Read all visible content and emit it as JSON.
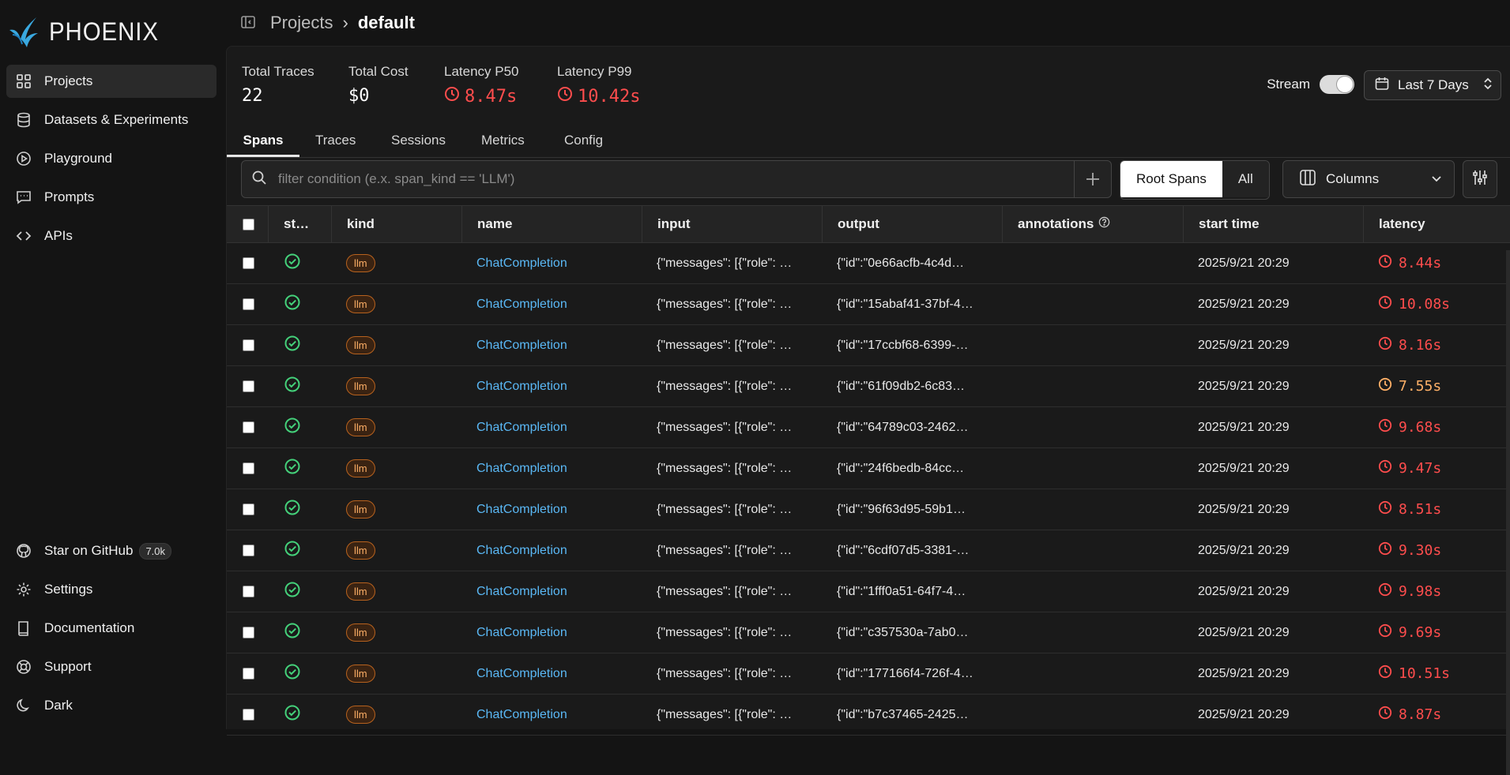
{
  "app": {
    "name": "PHOENIX"
  },
  "sidebar": {
    "items": [
      {
        "label": "Projects",
        "icon": "grid-icon",
        "active": true
      },
      {
        "label": "Datasets & Experiments",
        "icon": "database-icon"
      },
      {
        "label": "Playground",
        "icon": "play-circle-icon"
      },
      {
        "label": "Prompts",
        "icon": "message-icon"
      },
      {
        "label": "APIs",
        "icon": "code-icon"
      }
    ],
    "bottom": [
      {
        "label": "Star on GitHub",
        "icon": "github-icon",
        "badge": "7.0k"
      },
      {
        "label": "Settings",
        "icon": "gear-icon"
      },
      {
        "label": "Documentation",
        "icon": "book-icon"
      },
      {
        "label": "Support",
        "icon": "lifebuoy-icon"
      },
      {
        "label": "Dark",
        "icon": "moon-icon"
      }
    ]
  },
  "breadcrumb": {
    "parent": "Projects",
    "separator": "›",
    "current": "default"
  },
  "stats": {
    "total_traces": {
      "label": "Total Traces",
      "value": "22"
    },
    "total_cost": {
      "label": "Total Cost",
      "value": "$0"
    },
    "latency_p50": {
      "label": "Latency P50",
      "value": "8.47s"
    },
    "latency_p99": {
      "label": "Latency P99",
      "value": "10.42s"
    }
  },
  "stream": {
    "label": "Stream",
    "on": true
  },
  "date_range": {
    "label": "Last 7 Days"
  },
  "tabs": [
    {
      "label": "Spans",
      "active": true
    },
    {
      "label": "Traces"
    },
    {
      "label": "Sessions"
    },
    {
      "label": "Metrics"
    },
    {
      "label": "Config"
    }
  ],
  "filter": {
    "placeholder": "filter condition (e.x. span_kind == 'LLM')",
    "value": ""
  },
  "segment": {
    "root_spans": "Root Spans",
    "all": "All",
    "selected": "Root Spans"
  },
  "columns_button": {
    "label": "Columns"
  },
  "table": {
    "headers": {
      "status": "st…",
      "kind": "kind",
      "name": "name",
      "input": "input",
      "output": "output",
      "annotations": "annotations",
      "start_time": "start time",
      "latency": "latency"
    },
    "rows": [
      {
        "kind": "llm",
        "name": "ChatCompletion",
        "input": "{\"messages\": [{\"role\": …",
        "output": "{\"id\":\"0e66acfb-4c4d…",
        "start_time": "2025/9/21 20:29",
        "latency": "8.44s",
        "lat_color": "red"
      },
      {
        "kind": "llm",
        "name": "ChatCompletion",
        "input": "{\"messages\": [{\"role\": …",
        "output": "{\"id\":\"15abaf41-37bf-4…",
        "start_time": "2025/9/21 20:29",
        "latency": "10.08s",
        "lat_color": "red"
      },
      {
        "kind": "llm",
        "name": "ChatCompletion",
        "input": "{\"messages\": [{\"role\": …",
        "output": "{\"id\":\"17ccbf68-6399-…",
        "start_time": "2025/9/21 20:29",
        "latency": "8.16s",
        "lat_color": "red"
      },
      {
        "kind": "llm",
        "name": "ChatCompletion",
        "input": "{\"messages\": [{\"role\": …",
        "output": "{\"id\":\"61f09db2-6c83…",
        "start_time": "2025/9/21 20:29",
        "latency": "7.55s",
        "lat_color": "orange"
      },
      {
        "kind": "llm",
        "name": "ChatCompletion",
        "input": "{\"messages\": [{\"role\": …",
        "output": "{\"id\":\"64789c03-2462…",
        "start_time": "2025/9/21 20:29",
        "latency": "9.68s",
        "lat_color": "red"
      },
      {
        "kind": "llm",
        "name": "ChatCompletion",
        "input": "{\"messages\": [{\"role\": …",
        "output": "{\"id\":\"24f6bedb-84cc…",
        "start_time": "2025/9/21 20:29",
        "latency": "9.47s",
        "lat_color": "red"
      },
      {
        "kind": "llm",
        "name": "ChatCompletion",
        "input": "{\"messages\": [{\"role\": …",
        "output": "{\"id\":\"96f63d95-59b1…",
        "start_time": "2025/9/21 20:29",
        "latency": "8.51s",
        "lat_color": "red"
      },
      {
        "kind": "llm",
        "name": "ChatCompletion",
        "input": "{\"messages\": [{\"role\": …",
        "output": "{\"id\":\"6cdf07d5-3381-…",
        "start_time": "2025/9/21 20:29",
        "latency": "9.30s",
        "lat_color": "red"
      },
      {
        "kind": "llm",
        "name": "ChatCompletion",
        "input": "{\"messages\": [{\"role\": …",
        "output": "{\"id\":\"1fff0a51-64f7-4…",
        "start_time": "2025/9/21 20:29",
        "latency": "9.98s",
        "lat_color": "red"
      },
      {
        "kind": "llm",
        "name": "ChatCompletion",
        "input": "{\"messages\": [{\"role\": …",
        "output": "{\"id\":\"c357530a-7ab0…",
        "start_time": "2025/9/21 20:29",
        "latency": "9.69s",
        "lat_color": "red"
      },
      {
        "kind": "llm",
        "name": "ChatCompletion",
        "input": "{\"messages\": [{\"role\": …",
        "output": "{\"id\":\"177166f4-726f-4…",
        "start_time": "2025/9/21 20:29",
        "latency": "10.51s",
        "lat_color": "red"
      },
      {
        "kind": "llm",
        "name": "ChatCompletion",
        "input": "{\"messages\": [{\"role\": …",
        "output": "{\"id\":\"b7c37465-2425…",
        "start_time": "2025/9/21 20:29",
        "latency": "8.87s",
        "lat_color": "red"
      }
    ]
  },
  "colors": {
    "accent_blue": "#5ab8f5",
    "status_ok": "#44d17a",
    "latency_red": "#ff4d4d",
    "latency_orange": "#ffb067",
    "kind_badge": "#ffb067"
  }
}
